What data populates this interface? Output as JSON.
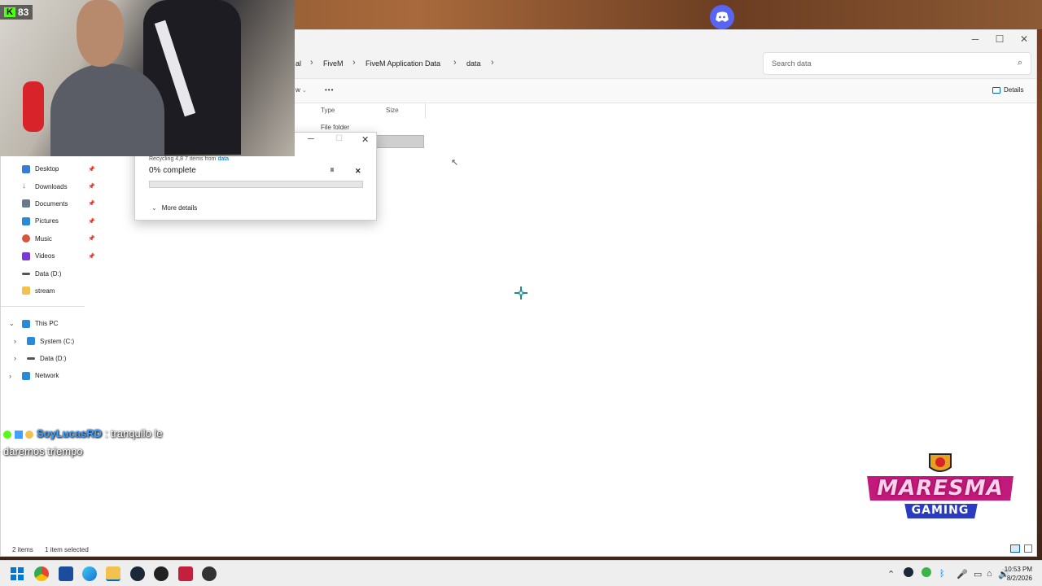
{
  "stream": {
    "viewer_badge_letter": "K",
    "viewer_count": "83",
    "chat": {
      "user": "SoyLucasRD",
      "message": ": tranquilo le daremos triempo"
    },
    "logo": {
      "line1": "MARESMA",
      "line2": "GAMING"
    }
  },
  "explorer": {
    "breadcrumb": [
      "al",
      "FiveM",
      "FiveM Application Data",
      "data"
    ],
    "search_placeholder": "Search data",
    "cmd": {
      "more_label": "•••",
      "view_fragment": "w",
      "details_label": "Details"
    },
    "columns": {
      "type": "Type",
      "size": "Size"
    },
    "rows": [
      {
        "type": "File folder",
        "size": ""
      }
    ],
    "nav_pinned": [
      {
        "label": "Desktop",
        "icon": "desktop-icon",
        "color": "#3a7bd5"
      },
      {
        "label": "Downloads",
        "icon": "download-icon",
        "color": "#2a9d4a"
      },
      {
        "label": "Documents",
        "icon": "document-icon",
        "color": "#6a7a8c"
      },
      {
        "label": "Pictures",
        "icon": "pictures-icon",
        "color": "#2a8ad5"
      },
      {
        "label": "Music",
        "icon": "music-icon",
        "color": "#d5563a"
      },
      {
        "label": "Videos",
        "icon": "videos-icon",
        "color": "#7a3ad5"
      }
    ],
    "nav_other": [
      {
        "label": "Data (D:)",
        "icon": "drive-icon",
        "color": "#555555"
      },
      {
        "label": "stream",
        "icon": "folder-icon",
        "color": "#f2c14e"
      }
    ],
    "tree": [
      {
        "label": "This PC",
        "icon": "pc-icon",
        "color": "#2a8ad5",
        "expanded": true,
        "level": 0
      },
      {
        "label": "System (C:)",
        "icon": "windows-drive-icon",
        "color": "#2a8ad5",
        "expanded": false,
        "level": 1
      },
      {
        "label": "Data (D:)",
        "icon": "drive-icon",
        "color": "#555555",
        "expanded": false,
        "level": 1
      },
      {
        "label": "Network",
        "icon": "network-icon",
        "color": "#2a8ad5",
        "expanded": false,
        "level": 0
      }
    ],
    "status": {
      "items": "2 items",
      "selected": "1 item selected"
    }
  },
  "dialog": {
    "subtitle_prefix": "Recycling 4",
    "subtitle_mid": ",8 7 items from",
    "subtitle_link": "data",
    "percent_label": "0% complete",
    "progress": 0,
    "pause_glyph": "II",
    "close_glyph": "✕",
    "more_details": "More details"
  },
  "taskbar": {
    "time": "10:53 PM",
    "date": "8/2/2026"
  },
  "colors": {
    "accent": "#0067c0",
    "progress": "#06b025",
    "kick_green": "#53fc18",
    "discord": "#5865f2"
  }
}
